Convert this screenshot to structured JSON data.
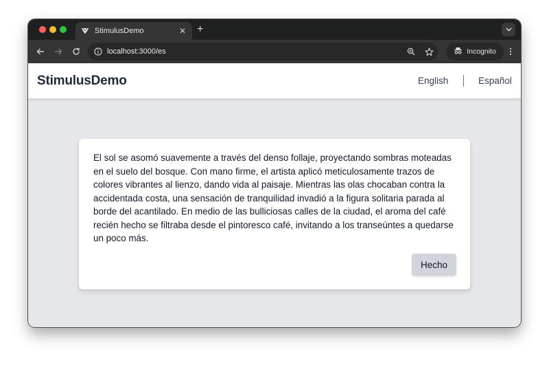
{
  "browser": {
    "tab": {
      "title": "StimulusDemo",
      "favicon": "stimulus-icon",
      "close_icon": "close-icon"
    },
    "new_tab_icon": "plus-icon",
    "tab_menu_icon": "chevron-down-icon",
    "toolbar": {
      "back_icon": "arrow-left-icon",
      "forward_icon": "arrow-right-icon",
      "reload_icon": "reload-icon",
      "site_info_icon": "info-icon",
      "url": "localhost:3000/es",
      "zoom_icon": "zoom-in-icon",
      "bookmark_icon": "star-icon",
      "incognito_label": "Incognito",
      "incognito_icon": "incognito-icon",
      "menu_icon": "kebab-menu-icon"
    }
  },
  "navbar": {
    "brand": "StimulusDemo",
    "languages": [
      {
        "label": "English"
      },
      {
        "label": "Español"
      }
    ]
  },
  "card": {
    "text": "El sol se asomó suavemente a través del denso follaje, proyectando sombras moteadas en el suelo del bosque. Con mano firme, el artista aplicó meticulosamente trazos de colores vibrantes al lienzo, dando vida al paisaje. Mientras las olas chocaban contra la accidentada costa, una sensación de tranquilidad invadió a la figura solitaria parada al borde del acantilado. En medio de las bulliciosas calles de la ciudad, el aroma del café recién hecho se filtraba desde el pintoresco café, invitando a los transeúntes a quedarse un poco más.",
    "button_label": "Hecho"
  }
}
